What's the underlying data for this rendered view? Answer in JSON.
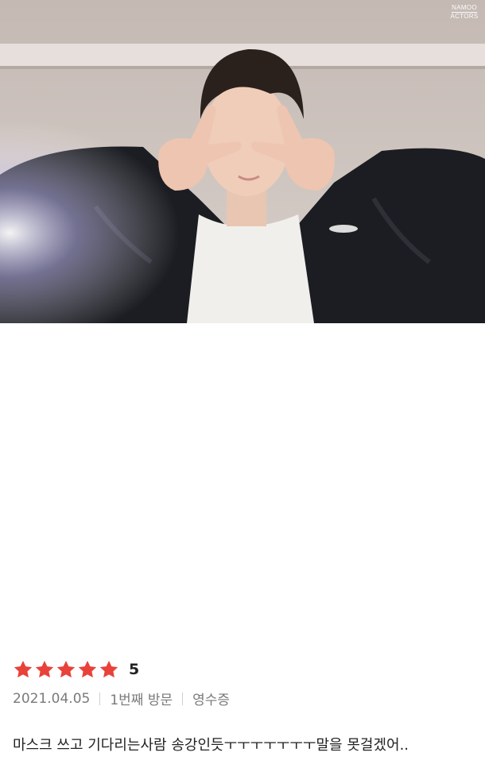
{
  "photo": {
    "watermark_top": "NAMOO",
    "watermark_bottom": "ACTORS"
  },
  "review": {
    "stars_count": 5,
    "star_color": "#e8423a",
    "rating_value": "5",
    "date": "2021.04.05",
    "visit": "1번째 방문",
    "receipt": "영수증",
    "text": "마스크 쓰고 기다리는사람 송강인듯ㅜㅜㅜㅜㅜㅜㅜ말을 못걸겠어.."
  }
}
